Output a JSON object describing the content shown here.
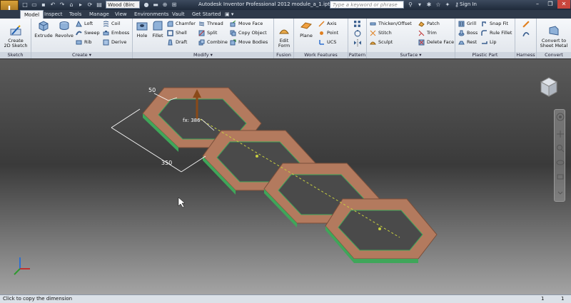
{
  "app": {
    "icon_letter": "I",
    "title": "Autodesk Inventor Professional 2012   module_a_1.ipt",
    "material": "Wood (Birc",
    "search_placeholder": "Type a keyword or phrase",
    "signin": "Sign In"
  },
  "tabs": [
    "Model",
    "Inspect",
    "Tools",
    "Manage",
    "View",
    "Environments",
    "Vault",
    "Get Started"
  ],
  "ribbon": {
    "sketch": {
      "title": "Sketch",
      "create_sketch": "Create\n2D Sketch"
    },
    "create": {
      "title": "Create",
      "extrude": "Extrude",
      "revolve": "Revolve",
      "loft": "Loft",
      "sweep": "Sweep",
      "rib": "Rib",
      "coil": "Coil",
      "emboss": "Emboss",
      "derive": "Derive"
    },
    "modify": {
      "title": "Modify",
      "hole": "Hole",
      "fillet": "Fillet",
      "chamfer": "Chamfer",
      "shell": "Shell",
      "draft": "Draft",
      "thread": "Thread",
      "split": "Split",
      "combine": "Combine",
      "move_face": "Move Face",
      "copy_object": "Copy Object",
      "move_bodies": "Move Bodies"
    },
    "fusion": {
      "title": "Fusion",
      "edit_form": "Edit\nForm"
    },
    "work_features": {
      "title": "Work Features",
      "plane": "Plane",
      "axis": "Axis",
      "point": "Point",
      "ucs": "UCS"
    },
    "pattern": {
      "title": "Pattern"
    },
    "surface": {
      "title": "Surface",
      "thicken": "Thicken/Offset",
      "stitch": "Stitch",
      "sculpt": "Sculpt",
      "patch": "Patch",
      "trim": "Trim",
      "delete_face": "Delete Face"
    },
    "plastic": {
      "title": "Plastic Part",
      "grill": "Grill",
      "boss": "Boss",
      "rest": "Rest",
      "snap_fit": "Snap Fit",
      "rule_fillet": "Rule Fillet",
      "lip": "Lip"
    },
    "harness": {
      "title": "Harness"
    },
    "convert": {
      "title": "Convert",
      "convert_sheet": "Convert to\nSheet Metal"
    }
  },
  "viewport": {
    "dim_top": "50",
    "dim_extrude": "fx: 386",
    "dim_side": "350",
    "colors": {
      "wood": "#b37a5e",
      "wood_dark": "#7a4f3a",
      "edge": "#3fa65a",
      "dim": "#ffffff"
    }
  },
  "status": {
    "message": "Click to copy the dimension",
    "count1": "1",
    "count2": "1"
  }
}
